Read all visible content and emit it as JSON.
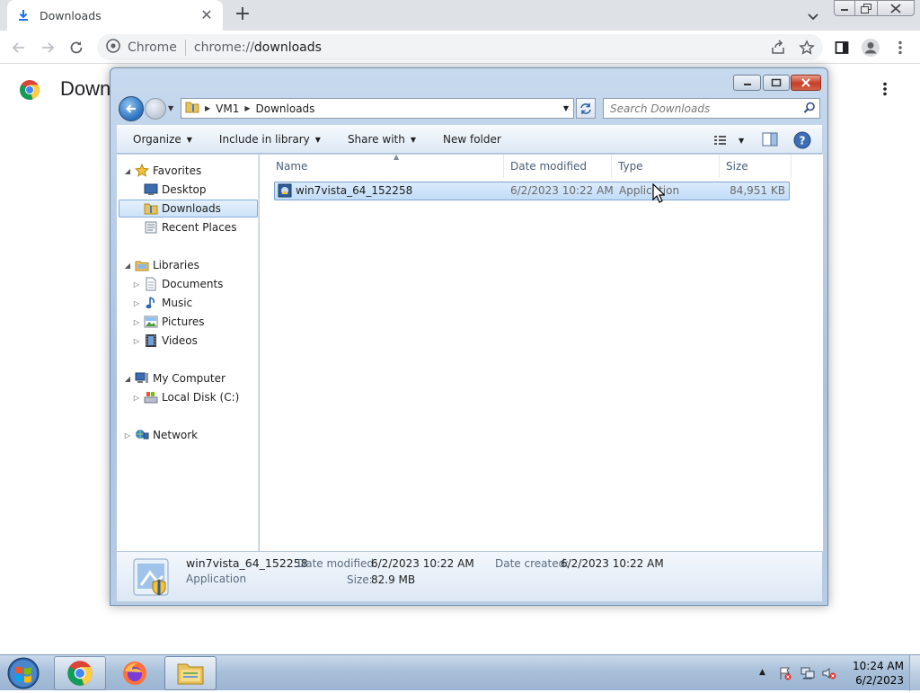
{
  "chrome": {
    "tab": {
      "title": "Downloads",
      "close": "✕"
    },
    "new_tab": "+",
    "omnibox": {
      "site_chip": "Chrome",
      "url_scheme": "chrome://",
      "url_path": "downloads"
    },
    "page_title": "Down"
  },
  "explorer": {
    "breadcrumbs": [
      "VM1",
      "Downloads"
    ],
    "search_placeholder": "Search Downloads",
    "commands": [
      {
        "label": "Organize",
        "has_menu": true
      },
      {
        "label": "Include in library",
        "has_menu": true
      },
      {
        "label": "Share with",
        "has_menu": true
      },
      {
        "label": "New folder",
        "has_menu": false
      }
    ],
    "nav": {
      "favorites": {
        "label": "Favorites",
        "items": [
          "Desktop",
          "Downloads",
          "Recent Places"
        ]
      },
      "libraries": {
        "label": "Libraries",
        "items": [
          "Documents",
          "Music",
          "Pictures",
          "Videos"
        ]
      },
      "computer": {
        "label": "My Computer",
        "items": [
          "Local Disk (C:)"
        ]
      },
      "network": {
        "label": "Network"
      }
    },
    "columns": [
      "Name",
      "Date modified",
      "Type",
      "Size"
    ],
    "files": [
      {
        "name": "win7vista_64_152258",
        "date_modified": "6/2/2023 10:22 AM",
        "type": "Application",
        "size": "84,951 KB",
        "selected": true
      }
    ],
    "details": {
      "name": "win7vista_64_152258",
      "kind": "Application",
      "date_modified_label": "Date modified:",
      "date_modified": "6/2/2023 10:22 AM",
      "date_created_label": "Date created:",
      "date_created": "6/2/2023 10:22 AM",
      "size_label": "Size:",
      "size": "82.9 MB"
    }
  },
  "taskbar": {
    "apps": [
      "start-orb",
      "chrome",
      "firefox",
      "windows-explorer"
    ],
    "clock_time": "10:24 AM",
    "clock_date": "6/2/2023"
  },
  "colors": {
    "chrome_tabstrip": "#dee1e6",
    "explorer_frame": "#aac3df",
    "selection": "#cde3f9",
    "taskbar": "#a9c0da"
  }
}
